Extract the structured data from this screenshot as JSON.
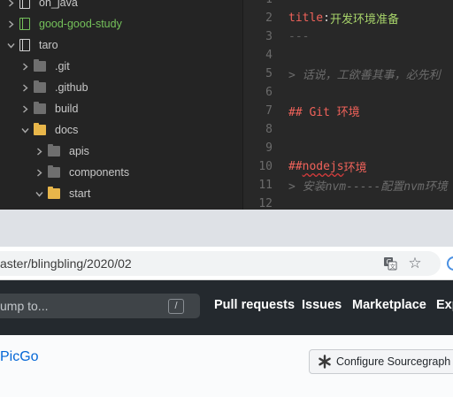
{
  "editor": {
    "tree": [
      {
        "label": "on_java",
        "kind": "repo",
        "expanded": false,
        "depth": 0
      },
      {
        "label": "good-good-study",
        "kind": "repo-green",
        "expanded": false,
        "depth": 0
      },
      {
        "label": "taro",
        "kind": "repo",
        "expanded": true,
        "depth": 0
      },
      {
        "label": ".git",
        "kind": "folder",
        "expanded": false,
        "depth": 1
      },
      {
        "label": ".github",
        "kind": "folder",
        "expanded": false,
        "depth": 1
      },
      {
        "label": "build",
        "kind": "folder",
        "expanded": false,
        "depth": 1
      },
      {
        "label": "docs",
        "kind": "folder-open",
        "expanded": true,
        "depth": 1
      },
      {
        "label": "apis",
        "kind": "folder",
        "expanded": false,
        "depth": 2
      },
      {
        "label": "components",
        "kind": "folder",
        "expanded": false,
        "depth": 2
      },
      {
        "label": "start",
        "kind": "folder-open",
        "expanded": true,
        "depth": 2
      }
    ],
    "lines": [
      {
        "num": "1",
        "parts": []
      },
      {
        "num": "2",
        "parts": [
          {
            "t": "title",
            "c": "c-key"
          },
          {
            "t": ": ",
            "c": "ctext"
          },
          {
            "t": "开发环境准备",
            "c": "c-val"
          }
        ]
      },
      {
        "num": "3",
        "parts": [
          {
            "t": "---",
            "c": "c-dim"
          }
        ]
      },
      {
        "num": "4",
        "parts": []
      },
      {
        "num": "5",
        "parts": [
          {
            "t": "> 话说，工欲善其事，必先利",
            "c": "c-quote"
          }
        ]
      },
      {
        "num": "6",
        "parts": []
      },
      {
        "num": "7",
        "parts": [
          {
            "t": "## Git 环境",
            "c": "c-head"
          }
        ]
      },
      {
        "num": "8",
        "parts": []
      },
      {
        "num": "9",
        "parts": []
      },
      {
        "num": "10",
        "parts": [
          {
            "t": "## ",
            "c": "c-head"
          },
          {
            "t": "nodejs",
            "c": "c-head c-underline"
          },
          {
            "t": " 环境",
            "c": "c-head"
          }
        ]
      },
      {
        "num": "11",
        "parts": [
          {
            "t": "> 安装nvm-----配置nvm环境",
            "c": "c-quote"
          }
        ]
      },
      {
        "num": "12",
        "parts": []
      }
    ]
  },
  "browser": {
    "url": "aster/blingbling/2020/02",
    "translate_icon": "translate-icon",
    "star_icon": "star-icon"
  },
  "github": {
    "search_placeholder": "ump to...",
    "slash_hint": "/",
    "nav": [
      "Pull requests",
      "Issues",
      "Marketplace",
      "Exp"
    ],
    "repo_name": "PicGo",
    "sourcegraph_button": "Configure Sourcegraph"
  },
  "colors": {
    "editor_bg": "#282828",
    "github_header": "#24292e",
    "link_blue": "#0366d6",
    "keyword_red": "#f0625a",
    "string_green": "#a7d36a"
  }
}
